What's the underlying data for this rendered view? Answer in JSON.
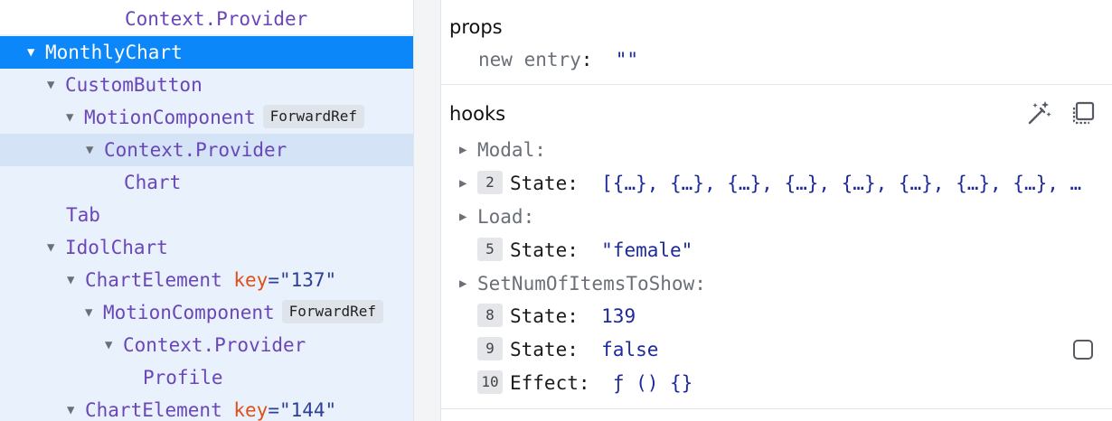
{
  "tree": {
    "rows": [
      {
        "name": "Context.Provider"
      },
      {
        "name": "MonthlyChart"
      },
      {
        "name": "CustomButton"
      },
      {
        "name": "MotionComponent",
        "badge": "ForwardRef"
      },
      {
        "name": "Context.Provider"
      },
      {
        "name": "Chart"
      },
      {
        "name": "Tab"
      },
      {
        "name": "IdolChart"
      },
      {
        "name": "ChartElement",
        "key_label": "key",
        "key_value": "\"137\""
      },
      {
        "name": "MotionComponent",
        "badge": "ForwardRef"
      },
      {
        "name": "Context.Provider"
      },
      {
        "name": "Profile"
      },
      {
        "name": "ChartElement",
        "key_label": "key",
        "key_value": "\"144\""
      }
    ]
  },
  "props": {
    "title": "props",
    "entries": [
      {
        "name": "new entry",
        "value": "\"\""
      }
    ]
  },
  "hooks": {
    "title": "hooks",
    "items": [
      {
        "name": "Modal:"
      },
      {
        "num": "2",
        "label": "State:",
        "value": "[{…}, {…}, {…}, {…}, {…}, {…}, {…}, {…}, …"
      },
      {
        "name": "Load:"
      },
      {
        "num": "5",
        "label": "State:",
        "value": "\"female\""
      },
      {
        "name": "SetNumOfItemsToShow:"
      },
      {
        "num": "8",
        "label": "State:",
        "value": "139"
      },
      {
        "num": "9",
        "label": "State:",
        "value": "false"
      },
      {
        "num": "10",
        "label": "Effect:",
        "value": "ƒ () {}"
      }
    ]
  },
  "colors": {
    "selected": "#0b87fa",
    "component": "#6a46b8",
    "key": "#e0501b",
    "value": "#1e2a9a"
  },
  "icons": {
    "parse_hooks": "magic-wand-icon",
    "copy": "copy-icon"
  }
}
